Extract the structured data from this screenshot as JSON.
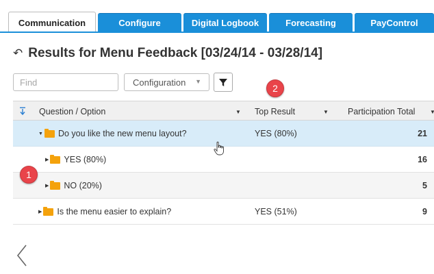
{
  "tabs": [
    {
      "label": "Communication",
      "active": true
    },
    {
      "label": "Configure"
    },
    {
      "label": "Digital Logbook"
    },
    {
      "label": "Forecasting"
    },
    {
      "label": "PayControl"
    }
  ],
  "page": {
    "title": "Results for Menu Feedback [03/24/14 - 03/28/14]"
  },
  "toolbar": {
    "find_placeholder": "Find",
    "configuration_label": "Configuration"
  },
  "badges": [
    "1",
    "2"
  ],
  "grid": {
    "columns": [
      "Question / Option",
      "Top Result",
      "Participation Total"
    ],
    "rows": [
      {
        "label": "Do you like the new menu layout?",
        "top_result": "YES (80%)",
        "total": "21"
      },
      {
        "label": "YES (80%)",
        "top_result": "",
        "total": "16"
      },
      {
        "label": "NO (20%)",
        "top_result": "",
        "total": "5"
      },
      {
        "label": "Is the menu easier to explain?",
        "top_result": "YES (51%)",
        "total": "9"
      }
    ]
  },
  "colors": {
    "tab_blue": "#1a8fd9",
    "selected_row": "#d8ecf9",
    "badge_red": "#e9444a",
    "folder": "#f4a20c"
  }
}
